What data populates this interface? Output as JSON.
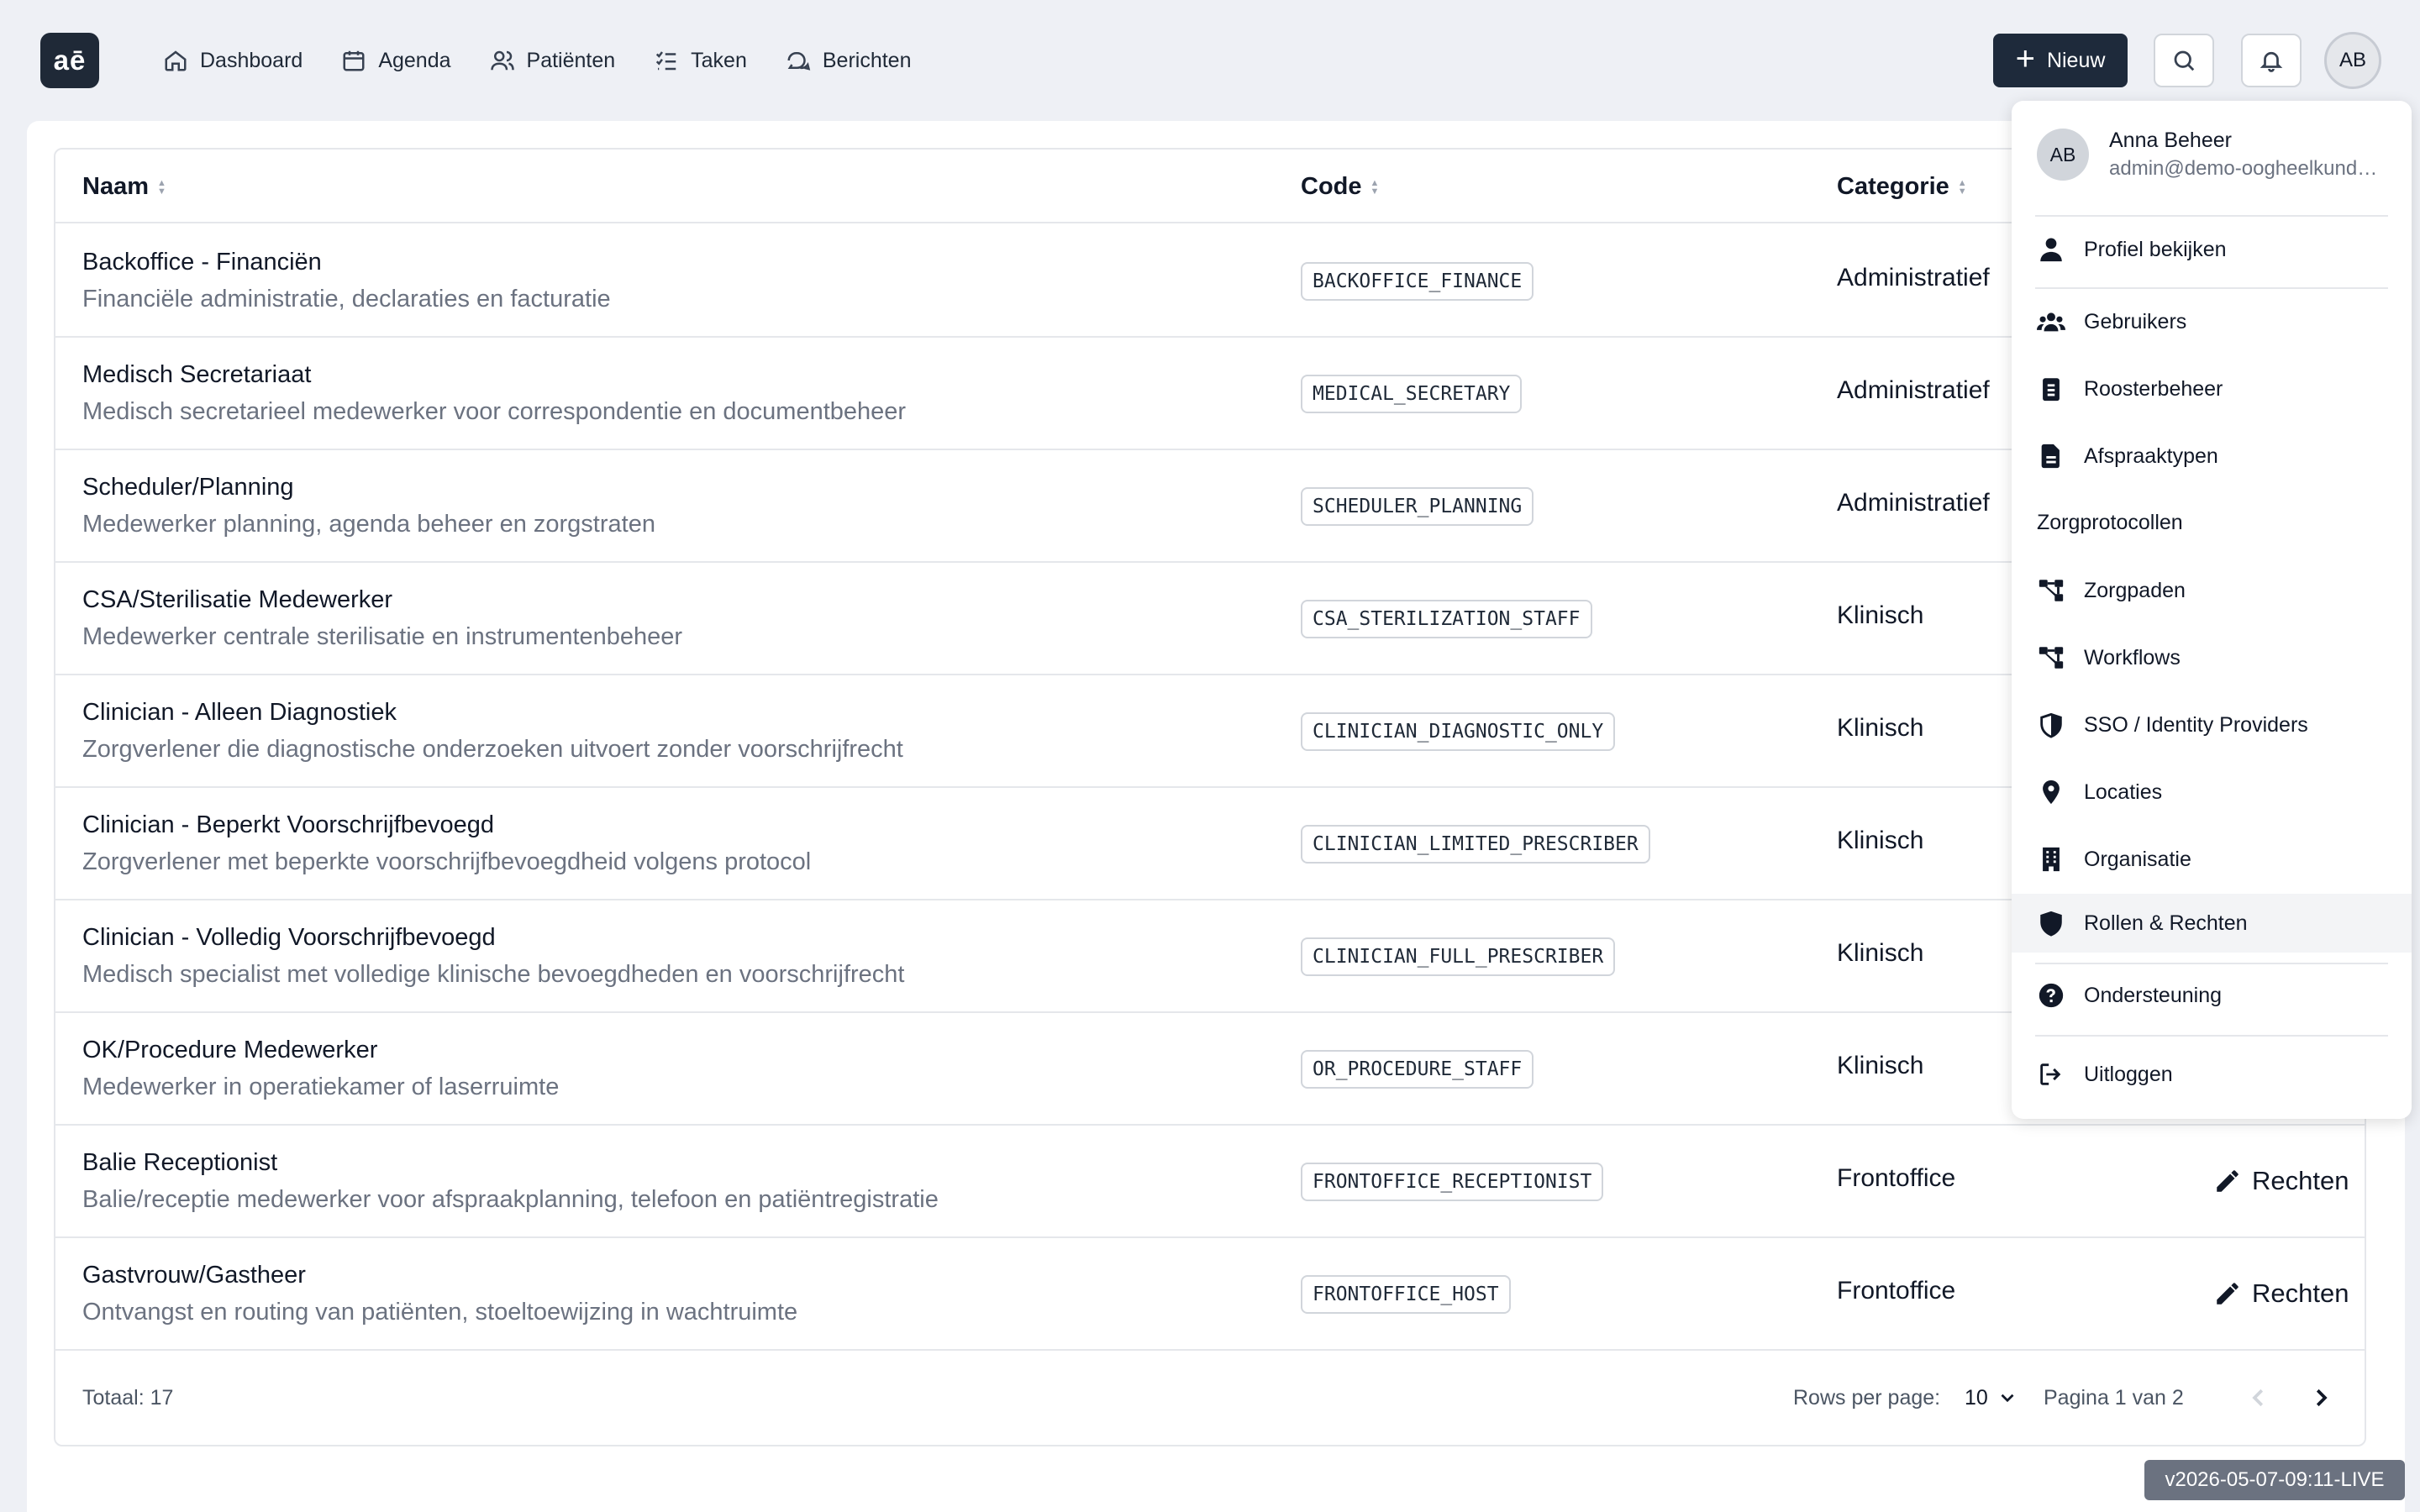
{
  "app": {
    "logo_text": "aē",
    "nav": [
      {
        "label": "Dashboard",
        "icon": "home-icon"
      },
      {
        "label": "Agenda",
        "icon": "calendar-icon"
      },
      {
        "label": "Patiënten",
        "icon": "users-icon"
      },
      {
        "label": "Taken",
        "icon": "tasks-icon"
      },
      {
        "label": "Berichten",
        "icon": "messages-icon"
      }
    ],
    "new_button": "Nieuw",
    "avatar_initials": "AB"
  },
  "table": {
    "headers": {
      "name": "Naam",
      "code": "Code",
      "category": "Categorie"
    },
    "rows": [
      {
        "title": "Backoffice - Financiën",
        "desc": "Financiële administratie, declaraties en facturatie",
        "code": "BACKOFFICE_FINANCE",
        "category": "Administratief",
        "action": ""
      },
      {
        "title": "Medisch Secretariaat",
        "desc": "Medisch secretarieel medewerker voor correspondentie en documentbeheer",
        "code": "MEDICAL_SECRETARY",
        "category": "Administratief",
        "action": ""
      },
      {
        "title": "Scheduler/Planning",
        "desc": "Medewerker planning, agenda beheer en zorgstraten",
        "code": "SCHEDULER_PLANNING",
        "category": "Administratief",
        "action": ""
      },
      {
        "title": "CSA/Sterilisatie Medewerker",
        "desc": "Medewerker centrale sterilisatie en instrumentenbeheer",
        "code": "CSA_STERILIZATION_STAFF",
        "category": "Klinisch",
        "action": ""
      },
      {
        "title": "Clinician - Alleen Diagnostiek",
        "desc": "Zorgverlener die diagnostische onderzoeken uitvoert zonder voorschrijfrecht",
        "code": "CLINICIAN_DIAGNOSTIC_ONLY",
        "category": "Klinisch",
        "action": ""
      },
      {
        "title": "Clinician - Beperkt Voorschrijfbevoegd",
        "desc": "Zorgverlener met beperkte voorschrijfbevoegdheid volgens protocol",
        "code": "CLINICIAN_LIMITED_PRESCRIBER",
        "category": "Klinisch",
        "action": ""
      },
      {
        "title": "Clinician - Volledig Voorschrijfbevoegd",
        "desc": "Medisch specialist met volledige klinische bevoegdheden en voorschrijfrecht",
        "code": "CLINICIAN_FULL_PRESCRIBER",
        "category": "Klinisch",
        "action": ""
      },
      {
        "title": "OK/Procedure Medewerker",
        "desc": "Medewerker in operatiekamer of laserruimte",
        "code": "OR_PROCEDURE_STAFF",
        "category": "Klinisch",
        "action": ""
      },
      {
        "title": "Balie Receptionist",
        "desc": "Balie/receptie medewerker voor afspraakplanning, telefoon en patiëntregistratie",
        "code": "FRONTOFFICE_RECEPTIONIST",
        "category": "Frontoffice",
        "action": "Rechten"
      },
      {
        "title": "Gastvrouw/Gastheer",
        "desc": "Ontvangst en routing van patiënten, stoeltoewijzing in wachtruimte",
        "code": "FRONTOFFICE_HOST",
        "category": "Frontoffice",
        "action": "Rechten"
      }
    ],
    "footer": {
      "total": "Totaal: 17",
      "rows_per_page_label": "Rows per page:",
      "rows_per_page_value": "10",
      "page_info": "Pagina 1 van 2"
    }
  },
  "user_menu": {
    "initials": "AB",
    "name": "Anna Beheer",
    "email": "admin@demo-oogheelkunde.nl",
    "items": {
      "profile": "Profiel bekijken",
      "users": "Gebruikers",
      "schedule": "Roosterbeheer",
      "appointment_types": "Afspraaktypen",
      "group_care_protocols": "Zorgprotocollen",
      "care_paths": "Zorgpaden",
      "workflows": "Workflows",
      "sso": "SSO / Identity Providers",
      "locations": "Locaties",
      "organization": "Organisatie",
      "roles": "Rollen & Rechten",
      "support": "Ondersteuning",
      "logout": "Uitloggen"
    },
    "active_item": "roles"
  },
  "version": "v2026-05-07-09:11-LIVE"
}
